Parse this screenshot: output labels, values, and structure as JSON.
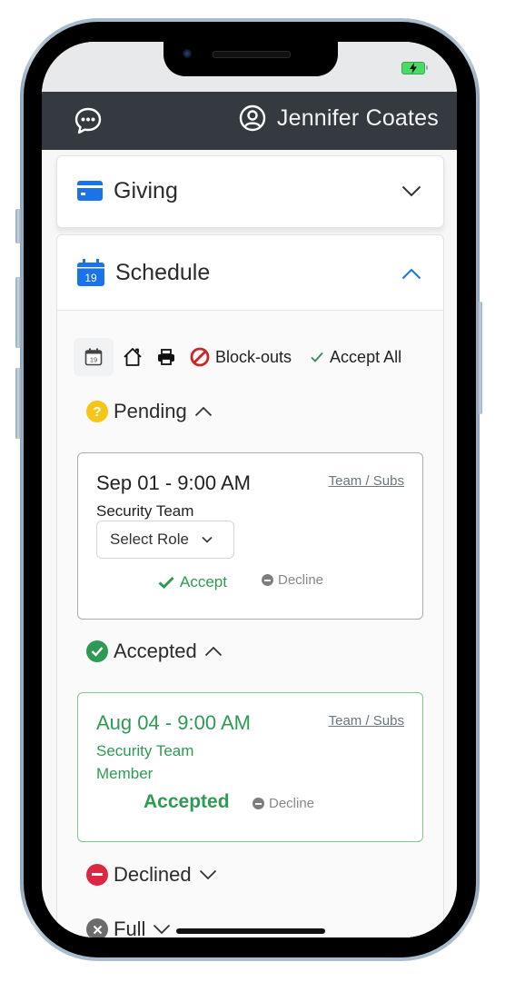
{
  "header": {
    "user_name": "Jennifer Coates",
    "chat_icon": "chat-bubble-dots-icon",
    "user_icon": "user-circle-icon"
  },
  "status_bar": {
    "battery_icon": "battery-charging-icon",
    "battery_color": "#4cd964"
  },
  "sections": {
    "giving": {
      "title": "Giving",
      "icon": "credit-card-icon",
      "expanded": false
    },
    "schedule": {
      "title": "Schedule",
      "icon": "calendar-19-icon",
      "calendar_day": "19",
      "expanded": true
    }
  },
  "toolbar": {
    "calendar_day": "19",
    "blockouts_label": "Block-outs",
    "accept_all_label": "Accept All"
  },
  "groups": {
    "pending": {
      "label": "Pending",
      "status_color": "#f5c518",
      "expanded": true,
      "events": [
        {
          "date": "Sep 01 - 9:00 AM",
          "team": "Security Team",
          "link": "Team / Subs",
          "role_placeholder": "Select Role",
          "accept_label": "Accept",
          "decline_label": "Decline"
        }
      ]
    },
    "accepted": {
      "label": "Accepted",
      "status_color": "#2e9a53",
      "expanded": true,
      "events": [
        {
          "date": "Aug 04 - 9:00 AM",
          "team": "Security Team",
          "role": "Member",
          "link": "Team / Subs",
          "status_label": "Accepted",
          "decline_label": "Decline"
        }
      ]
    },
    "declined": {
      "label": "Declined",
      "status_color": "#dc2743",
      "expanded": false
    },
    "full": {
      "label": "Full",
      "status_color": "#6c6c6c",
      "expanded": false
    }
  },
  "colors": {
    "header_bg": "#343a40",
    "accent_blue": "#1a73e8",
    "success_green": "#2e9a53",
    "blockout_red": "#c62828"
  }
}
